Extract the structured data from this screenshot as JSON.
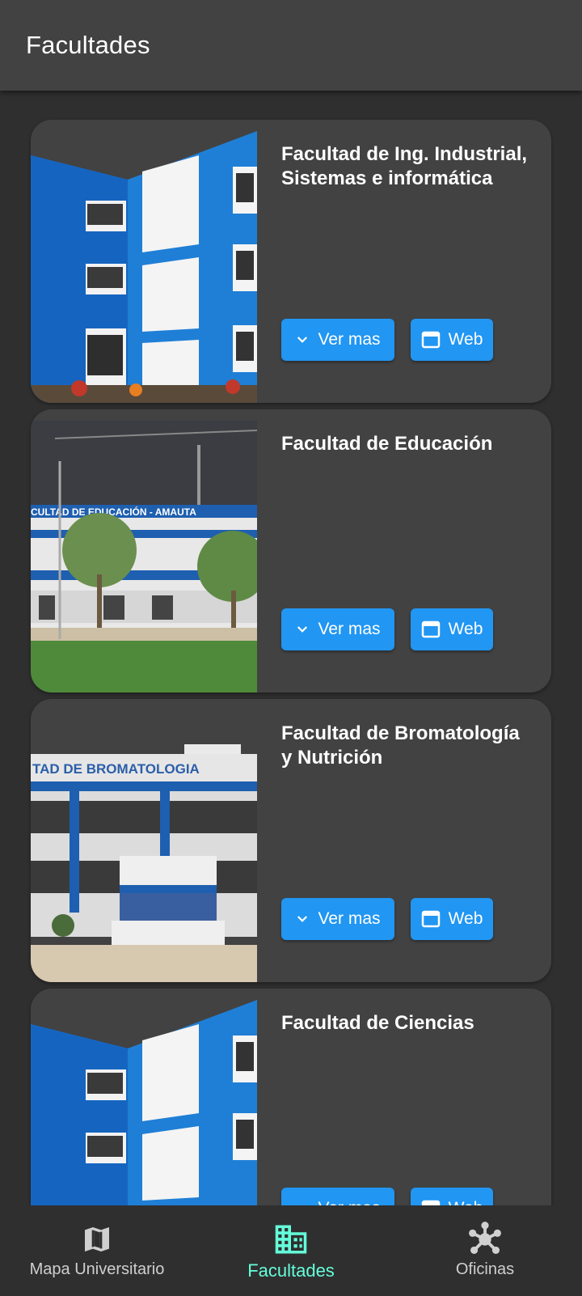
{
  "appbar": {
    "title": "Facultades"
  },
  "cards": [
    {
      "title": "Facultad de Ing. Industrial, Sistemas e informática",
      "more_label": "Ver mas",
      "web_label": "Web"
    },
    {
      "title": "Facultad de Educación",
      "more_label": "Ver mas",
      "web_label": "Web",
      "photo_sign": "CULTAD DE EDUCACIÓN  -  AMAUTA"
    },
    {
      "title": "Facultad de Bromatología y Nutrición",
      "more_label": "Ver mas",
      "web_label": "Web",
      "photo_sign": "TAD DE BROMATOLOGIA"
    },
    {
      "title": "Facultad de Ciencias",
      "more_label": "Ver mas",
      "web_label": "Web"
    }
  ],
  "nav": [
    {
      "label": "Mapa Universitario",
      "icon": "map-icon",
      "active": false
    },
    {
      "label": "Facultades",
      "icon": "building-icon",
      "active": true
    },
    {
      "label": "Oficinas",
      "icon": "hub-icon",
      "active": false
    }
  ],
  "colors": {
    "accent": "#2196f3",
    "nav_active": "#64ffda",
    "card": "#424242",
    "background": "#2f2f2f"
  }
}
